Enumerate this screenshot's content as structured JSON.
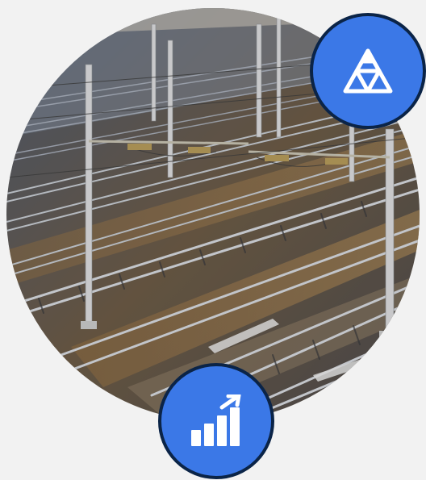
{
  "photo": {
    "subject": "railway-yard-tracks-with-overhead-catenary-masts"
  },
  "badges": {
    "top": {
      "icon": "triangle-network-icon",
      "color": "#3b78e7"
    },
    "bottom": {
      "icon": "growth-chart-icon",
      "color": "#3b78e7"
    }
  },
  "colors": {
    "background": "#f2f2f2",
    "badge_fill": "#3b78e7",
    "badge_border": "#0b2447",
    "icon": "#ffffff"
  }
}
